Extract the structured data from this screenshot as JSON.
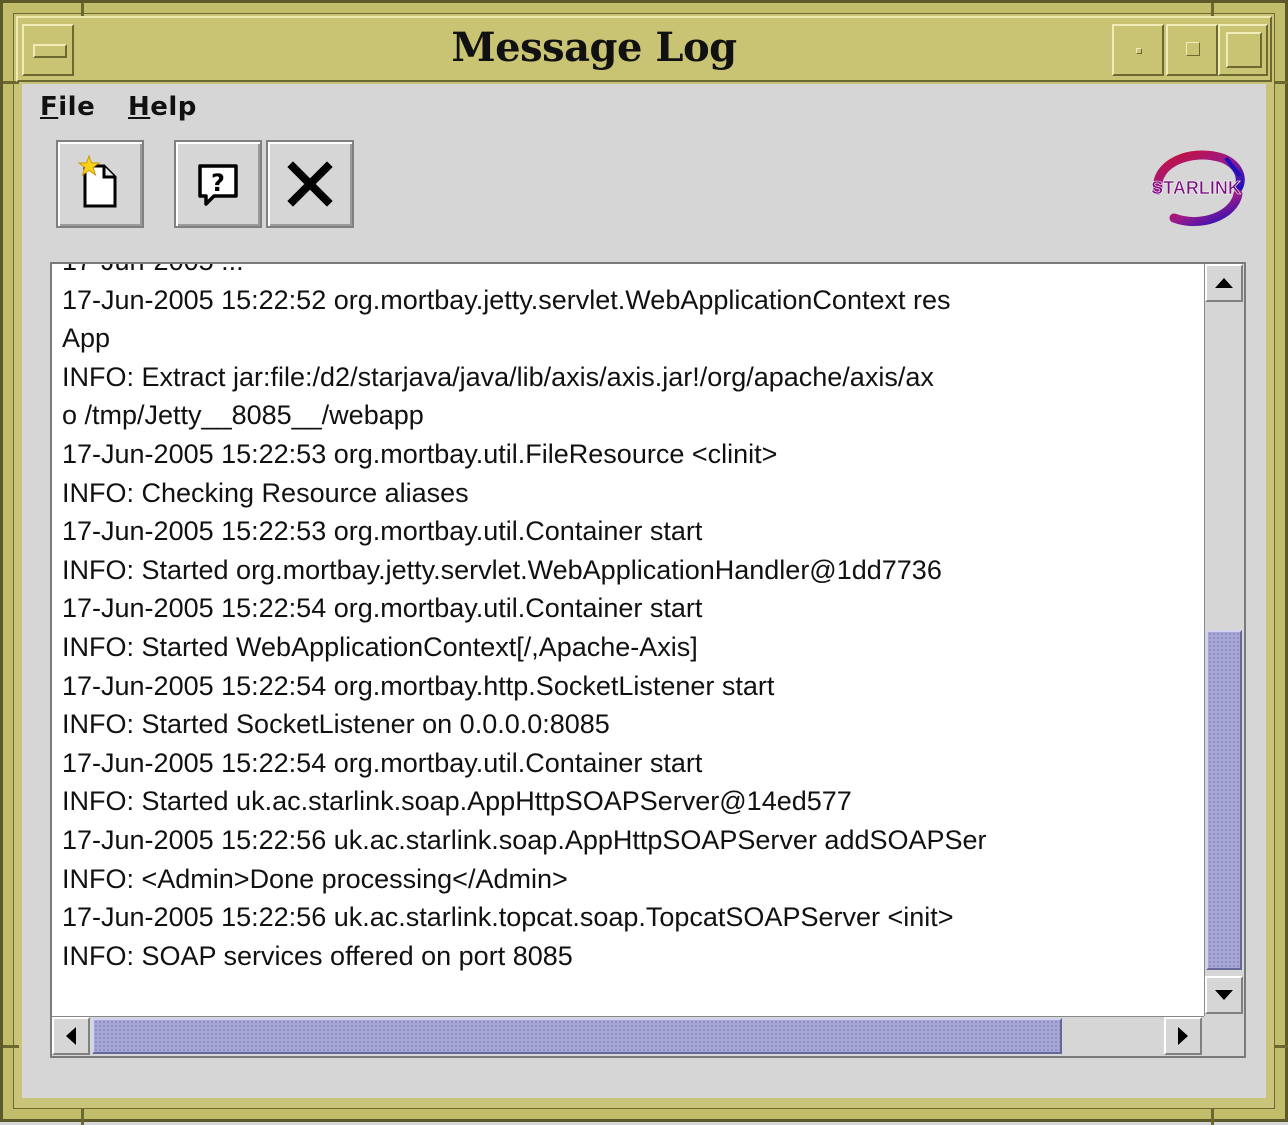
{
  "window": {
    "title": "Message Log"
  },
  "menubar": {
    "file": {
      "mnemonic": "F",
      "rest": "ile"
    },
    "help": {
      "mnemonic": "H",
      "rest": "elp"
    }
  },
  "toolbar": {
    "buttons": [
      {
        "icon": "new-page-icon"
      },
      {
        "icon": "help-icon"
      },
      {
        "icon": "close-icon"
      }
    ],
    "logo_text": "STARLINK"
  },
  "log": {
    "lines": [
      "17-Jun-2005 15:22:52 org.mortbay.jetty.servlet.WebApplicationContext res",
      "App",
      "INFO: Extract jar:file:/d2/starjava/java/lib/axis/axis.jar!/org/apache/axis/ax",
      "o /tmp/Jetty__8085__/webapp",
      "17-Jun-2005 15:22:53 org.mortbay.util.FileResource <clinit>",
      "INFO: Checking Resource aliases",
      "17-Jun-2005 15:22:53 org.mortbay.util.Container start",
      "INFO: Started org.mortbay.jetty.servlet.WebApplicationHandler@1dd7736",
      "17-Jun-2005 15:22:54 org.mortbay.util.Container start",
      "INFO: Started WebApplicationContext[/,Apache-Axis]",
      "17-Jun-2005 15:22:54 org.mortbay.http.SocketListener start",
      "INFO: Started SocketListener on 0.0.0.0:8085",
      "17-Jun-2005 15:22:54 org.mortbay.util.Container start",
      "INFO: Started uk.ac.starlink.soap.AppHttpSOAPServer@14ed577",
      "17-Jun-2005 15:22:56 uk.ac.starlink.soap.AppHttpSOAPServer addSOAPSer",
      "INFO: <Admin>Done processing</Admin>",
      "17-Jun-2005 15:22:56 uk.ac.starlink.topcat.soap.TopcatSOAPServer <init>",
      "INFO: SOAP services offered on port 8085"
    ]
  },
  "scroll": {
    "vertical_position": 1.0,
    "horizontal_position": 0.0
  }
}
